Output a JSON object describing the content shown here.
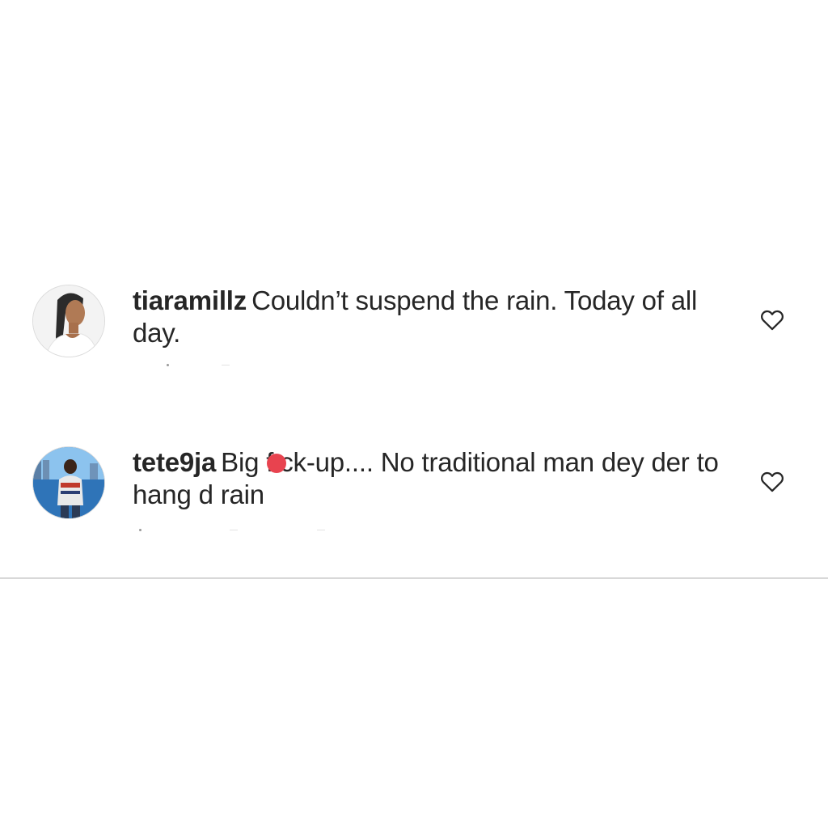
{
  "comments": [
    {
      "username": "tiaramillz",
      "text": "Couldn’t suspend the rain. Today of all day."
    },
    {
      "username": "tete9ja",
      "text_before": "Big f",
      "text_after": "ck-up.... No traditional man dey der to hang d rain"
    }
  ],
  "icons": {
    "like": "heart-outline-icon"
  },
  "colors": {
    "text": "#262626",
    "divider": "#d8d8d8",
    "censor_dot": "#e8434f"
  }
}
